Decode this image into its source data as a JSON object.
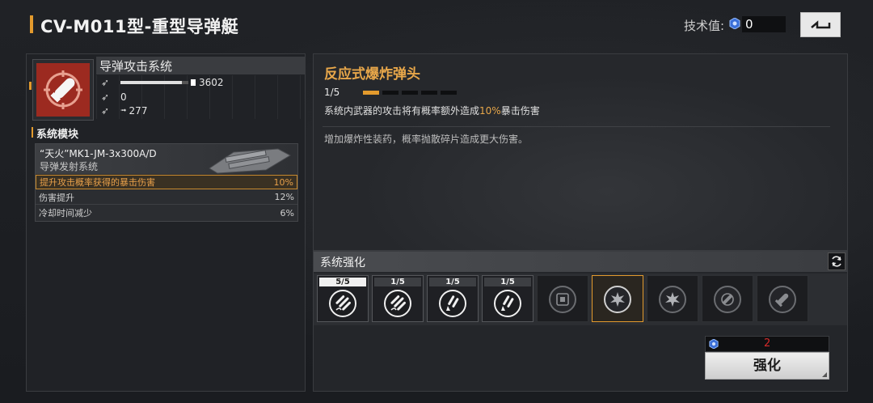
{
  "header": {
    "title": "CV-M011型-重型导弹艇",
    "tech_label": "技术值:",
    "tech_value": "0",
    "back_icon": "back-arrow-icon"
  },
  "system": {
    "name": "导弹攻击系统",
    "icon": "missile-icon",
    "stats": [
      {
        "icon": "attack-icon",
        "value": "3602",
        "bar_fraction": 0.9
      },
      {
        "icon": "defense-icon",
        "value": "0"
      },
      {
        "icon": "speed-icon",
        "value": "277",
        "prefix_icon": "arrow-right-icon"
      }
    ]
  },
  "modules": {
    "heading": "系统模块",
    "card": {
      "name": "“天火”MK1-JM-3x300A/D",
      "type": "导弹发射系统",
      "rows": [
        {
          "label": "提升攻击概率获得的暴击伤害",
          "value": "10%"
        },
        {
          "label": "伤害提升",
          "value": "12%"
        },
        {
          "label": "冷却时间减少",
          "value": "6%"
        }
      ]
    }
  },
  "warhead": {
    "title": "反应式爆炸弹头",
    "level_text": "1/5",
    "level": 1,
    "level_max": 5,
    "effect_prefix": "系统内武器的攻击将有概率额外造成",
    "effect_accent": "10%",
    "effect_suffix": "暴击伤害",
    "description": "增加爆炸性装药，概率抛散碎片造成更大伤害。"
  },
  "enhance": {
    "title": "系统强化",
    "refresh_icon": "refresh-icon",
    "slots": [
      {
        "level": "5/5",
        "icon": "missile-volley-icon",
        "state": "max"
      },
      {
        "level": "1/5",
        "icon": "missile-volley-icon",
        "state": "active"
      },
      {
        "level": "1/5",
        "icon": "missile-launch-icon",
        "state": "active"
      },
      {
        "level": "1/5",
        "icon": "missile-launch-icon",
        "state": "active"
      },
      {
        "level": "",
        "icon": "chip-icon",
        "state": "locked"
      },
      {
        "level": "",
        "icon": "explosion-icon",
        "state": "selected"
      },
      {
        "level": "",
        "icon": "explosion-icon",
        "state": "locked"
      },
      {
        "level": "",
        "icon": "target-missile-icon",
        "state": "locked"
      },
      {
        "level": "",
        "icon": "missile-icon",
        "state": "locked"
      }
    ],
    "cost_value": "2",
    "button_label": "强化"
  },
  "colors": {
    "accent": "#e39a2d",
    "accent_text": "#e8a74a",
    "cost_red": "#d42a2a"
  }
}
